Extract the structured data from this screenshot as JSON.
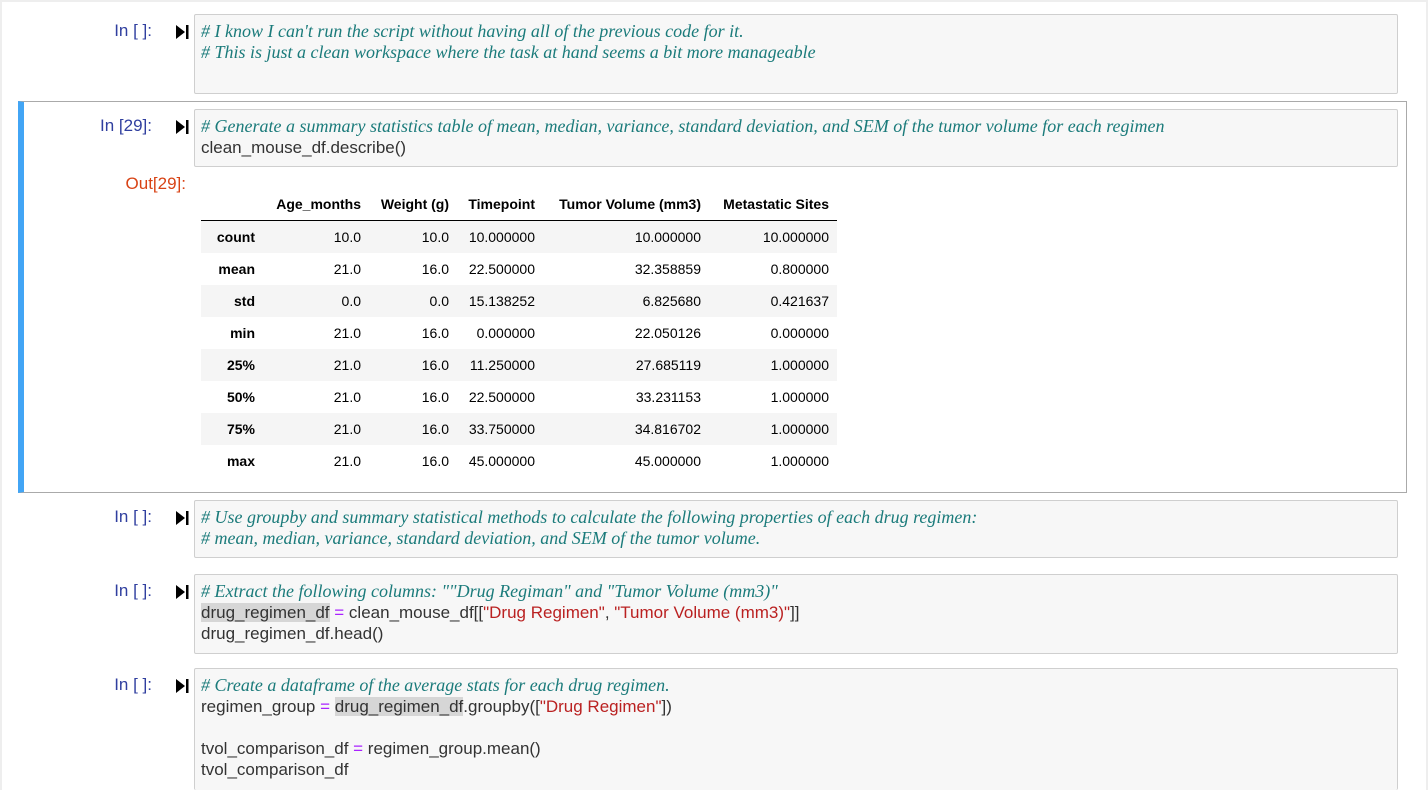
{
  "cells": [
    {
      "prompt": "In [ ]:",
      "lines": [
        [
          {
            "t": "# I know I can't run the script without having all of the previous code for it.",
            "c": "comment"
          }
        ],
        [
          {
            "t": "# This is just a clean workspace where the task at hand seems a bit more manageable",
            "c": "comment"
          }
        ]
      ]
    },
    {
      "prompt": "In [29]:",
      "out_prompt": "Out[29]:",
      "lines": [
        [
          {
            "t": "# Generate a summary statistics table of mean, median, variance, standard deviation, and SEM of the tumor volume for each regimen",
            "c": "comment"
          }
        ],
        [
          {
            "t": "clean_mouse_df.describe()",
            "c": ""
          }
        ]
      ]
    },
    {
      "prompt": "In [ ]:",
      "lines": [
        [
          {
            "t": "# Use groupby and summary statistical methods to calculate the following properties of each drug regimen:",
            "c": "comment"
          }
        ],
        [
          {
            "t": "# mean, median, variance, standard deviation, and SEM of the tumor volume.",
            "c": "comment"
          }
        ]
      ]
    },
    {
      "prompt": "In [ ]:",
      "lines": [
        [
          {
            "t": "# Extract the following columns: \"\"Drug Regiman\" and \"Tumor Volume (mm3)\"",
            "c": "comment"
          }
        ],
        [
          {
            "t": "drug_regimen_df",
            "c": "hl"
          },
          {
            "t": " ",
            "c": ""
          },
          {
            "t": "=",
            "c": "op"
          },
          {
            "t": " clean_mouse_df[[",
            "c": ""
          },
          {
            "t": "\"Drug Regimen\"",
            "c": "str"
          },
          {
            "t": ", ",
            "c": ""
          },
          {
            "t": "\"Tumor Volume (mm3)\"",
            "c": "str"
          },
          {
            "t": "]]",
            "c": ""
          }
        ],
        [
          {
            "t": "drug_regimen_df.head()",
            "c": ""
          }
        ]
      ]
    },
    {
      "prompt": "In [ ]:",
      "lines": [
        [
          {
            "t": "# Create a dataframe of the average stats for each drug regimen.",
            "c": "comment"
          }
        ],
        [
          {
            "t": "regimen_group ",
            "c": ""
          },
          {
            "t": "=",
            "c": "op"
          },
          {
            "t": " ",
            "c": ""
          },
          {
            "t": "drug_regimen_df",
            "c": "hl"
          },
          {
            "t": ".groupby([",
            "c": ""
          },
          {
            "t": "\"Drug Regimen\"",
            "c": "str"
          },
          {
            "t": "])",
            "c": ""
          }
        ],
        [
          {
            "t": " ",
            "c": ""
          }
        ],
        [
          {
            "t": "tvol_comparison_df ",
            "c": ""
          },
          {
            "t": "=",
            "c": "op"
          },
          {
            "t": " regimen_group.mean()",
            "c": ""
          }
        ],
        [
          {
            "t": "tvol_comparison_df",
            "c": ""
          }
        ]
      ]
    }
  ],
  "output_table": {
    "columns": [
      "",
      "Age_months",
      "Weight (g)",
      "Timepoint",
      "Tumor Volume (mm3)",
      "Metastatic Sites"
    ],
    "rows": [
      [
        "count",
        "10.0",
        "10.0",
        "10.000000",
        "10.000000",
        "10.000000"
      ],
      [
        "mean",
        "21.0",
        "16.0",
        "22.500000",
        "32.358859",
        "0.800000"
      ],
      [
        "std",
        "0.0",
        "0.0",
        "15.138252",
        "6.825680",
        "0.421637"
      ],
      [
        "min",
        "21.0",
        "16.0",
        "0.000000",
        "22.050126",
        "0.000000"
      ],
      [
        "25%",
        "21.0",
        "16.0",
        "11.250000",
        "27.685119",
        "1.000000"
      ],
      [
        "50%",
        "21.0",
        "16.0",
        "22.500000",
        "33.231153",
        "1.000000"
      ],
      [
        "75%",
        "21.0",
        "16.0",
        "33.750000",
        "34.816702",
        "1.000000"
      ],
      [
        "max",
        "21.0",
        "16.0",
        "45.000000",
        "45.000000",
        "1.000000"
      ]
    ]
  },
  "colors": {
    "prompt_in": "#303f9f",
    "prompt_out": "#d84315",
    "comment": "#1b7b7b",
    "string": "#ba2121",
    "operator": "#aa22ff",
    "selected_bar": "#42a5f5"
  },
  "icons": {
    "run": "step-run-icon"
  }
}
